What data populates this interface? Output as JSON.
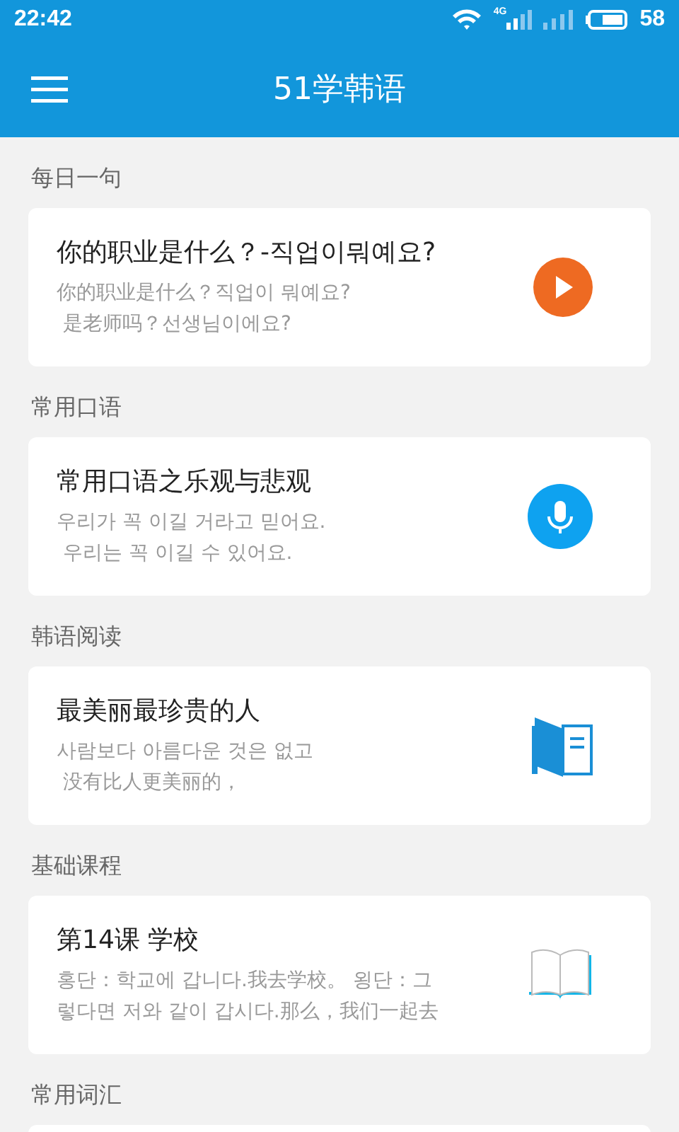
{
  "status_bar": {
    "time": "22:42",
    "network": "4G",
    "battery": "58"
  },
  "app_bar": {
    "title": "51学韩语"
  },
  "sections": [
    {
      "label": "每日一句",
      "card": {
        "kind": "play",
        "title": "你的职业是什么？-직업이뭐예요?",
        "lines": [
          "你的职业是什么？직업이 뭐예요?",
          " 是老师吗？선생님이에요?"
        ]
      }
    },
    {
      "label": "常用口语",
      "card": {
        "kind": "mic",
        "title": "常用口语之乐观与悲观",
        "lines": [
          "우리가 꼭 이길 거라고 믿어요.",
          " 우리는 꼭 이길 수 있어요."
        ]
      }
    },
    {
      "label": "韩语阅读",
      "card": {
        "kind": "reader",
        "title": "最美丽最珍贵的人",
        "lines": [
          "사람보다 아름다운 것은 없고",
          " 没有比人更美丽的，"
        ]
      }
    },
    {
      "label": "基础课程",
      "card": {
        "kind": "book",
        "title": "第14课 学校",
        "lines": [
          "홍단：학교에 갑니다.我去学校。 욍단：그",
          "렇다면 저와 같이 갑시다.那么，我们一起去"
        ]
      }
    },
    {
      "label": "常用词汇",
      "card": {
        "kind": "blank"
      }
    }
  ]
}
